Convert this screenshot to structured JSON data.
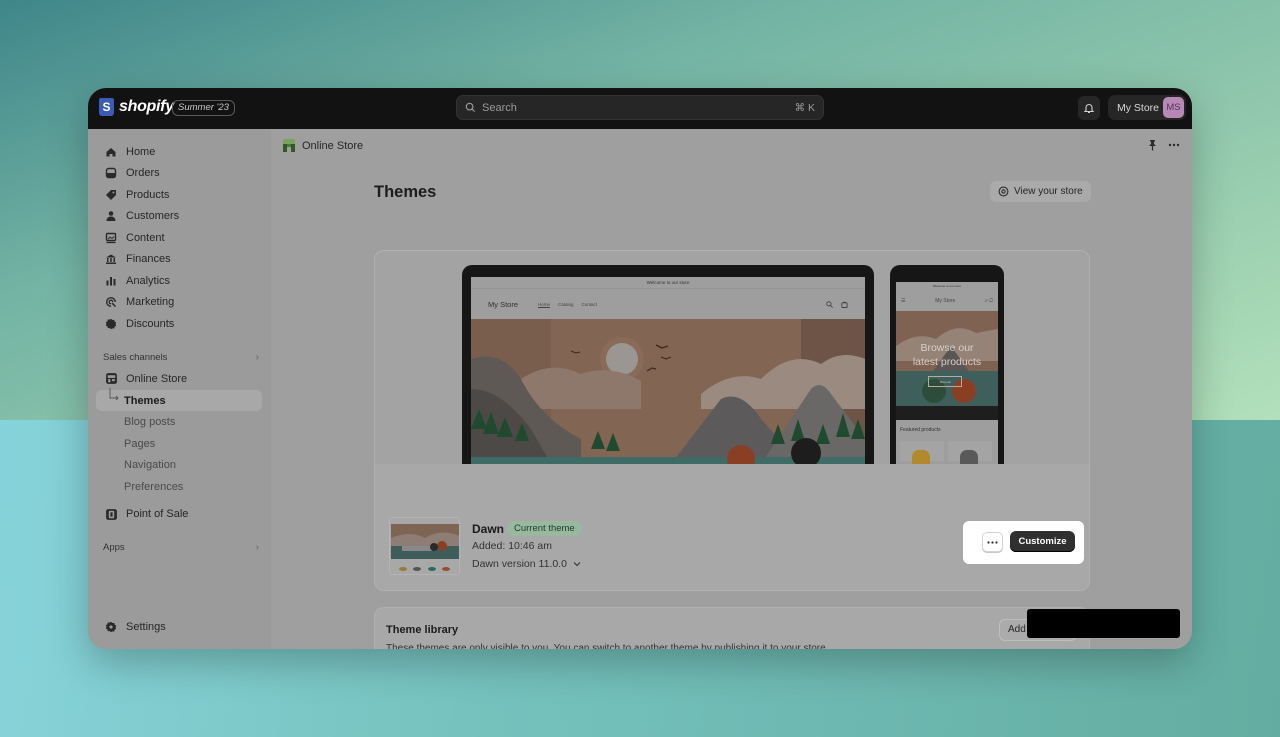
{
  "topbar": {
    "brand": "shopify",
    "brand_letter": "S",
    "edition": "Summer '23",
    "search_placeholder": "Search",
    "search_shortcut": "⌘ K",
    "store_name": "My Store",
    "avatar_initials": "MS"
  },
  "sidebar": {
    "items": [
      {
        "label": "Home",
        "icon": "home-icon"
      },
      {
        "label": "Orders",
        "icon": "orders-icon"
      },
      {
        "label": "Products",
        "icon": "tag-icon"
      },
      {
        "label": "Customers",
        "icon": "person-icon"
      },
      {
        "label": "Content",
        "icon": "content-icon"
      },
      {
        "label": "Finances",
        "icon": "bank-icon"
      },
      {
        "label": "Analytics",
        "icon": "bar-chart-icon"
      },
      {
        "label": "Marketing",
        "icon": "target-icon"
      },
      {
        "label": "Discounts",
        "icon": "discount-icon"
      }
    ],
    "sales_channels_label": "Sales channels",
    "online_store": {
      "label": "Online Store",
      "icon": "store-icon"
    },
    "sub_items": [
      {
        "label": "Themes",
        "active": true
      },
      {
        "label": "Blog posts"
      },
      {
        "label": "Pages"
      },
      {
        "label": "Navigation"
      },
      {
        "label": "Preferences"
      }
    ],
    "point_of_sale": {
      "label": "Point of Sale",
      "icon": "pos-icon"
    },
    "apps_label": "Apps",
    "settings_label": "Settings"
  },
  "header": {
    "breadcrumb": "Online Store",
    "page_title": "Themes",
    "view_store_label": "View your store"
  },
  "preview": {
    "announcement": "Welcome to our store",
    "store_name": "My Store",
    "nav_links": [
      "Home",
      "Catalog",
      "Contact"
    ],
    "mobile_hero_line1": "Browse our",
    "mobile_hero_line2": "latest products",
    "mobile_shop_button": "Shop all",
    "featured_label": "Featured products"
  },
  "current_theme": {
    "name": "Dawn",
    "badge": "Current theme",
    "added": "Added: 10:46 am",
    "version": "Dawn version 11.0.0",
    "customize_label": "Customize"
  },
  "library": {
    "title": "Theme library",
    "description": "These themes are only visible to you. You can switch to another theme by publishing it to your store.",
    "add_button": "Add"
  },
  "colors": {
    "topbar": "#121212",
    "badge_bg": "#98b9a0",
    "customize_bg": "#303030",
    "avatar_bg": "#b789b4"
  }
}
